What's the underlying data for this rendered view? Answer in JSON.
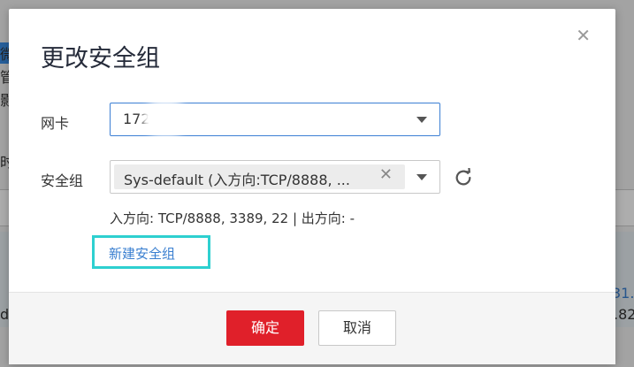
{
  "background": {
    "fragments": [
      "微",
      "管",
      "影",
      "时",
      "31.",
      "d-",
      ".82"
    ]
  },
  "dialog": {
    "title": "更改安全组",
    "close_icon": "close-icon",
    "nic_label": "网卡",
    "nic_value": "172      .82",
    "sg_label": "安全组",
    "sg_tag": "Sys-default (入方向:TCP/8888, ...",
    "sg_tag_remove_icon": "close-icon",
    "refresh_icon": "refresh-icon",
    "rule_text": "入方向: TCP/8888, 3389, 22 | 出方向: -",
    "new_sg_link": "新建安全组",
    "ok_label": "确定",
    "cancel_label": "取消"
  },
  "colors": {
    "primary": "#e0202a",
    "link": "#3a7fd0",
    "highlight": "#2ed0d0",
    "focus_border": "#3c7fd4"
  }
}
